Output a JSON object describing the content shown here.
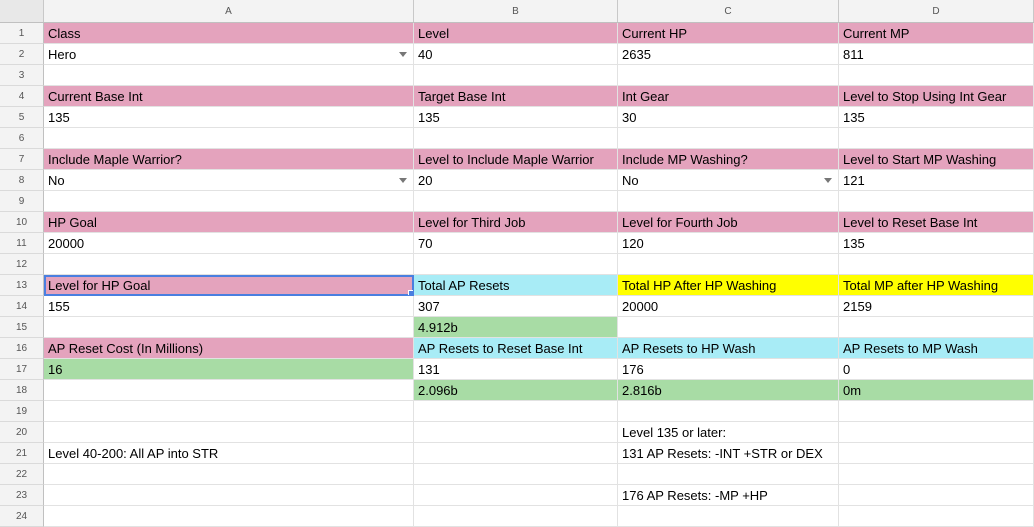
{
  "columns": [
    "A",
    "B",
    "C",
    "D"
  ],
  "rows": [
    {
      "num": "1",
      "cells": [
        {
          "text": "Class",
          "fill": "pink"
        },
        {
          "text": "Level",
          "fill": "pink"
        },
        {
          "text": "Current HP",
          "fill": "pink"
        },
        {
          "text": "Current MP",
          "fill": "pink"
        }
      ]
    },
    {
      "num": "2",
      "cells": [
        {
          "text": "Hero",
          "dropdown": true
        },
        {
          "text": "40"
        },
        {
          "text": "2635"
        },
        {
          "text": "811"
        }
      ]
    },
    {
      "num": "3",
      "cells": [
        {
          "text": ""
        },
        {
          "text": ""
        },
        {
          "text": ""
        },
        {
          "text": ""
        }
      ]
    },
    {
      "num": "4",
      "cells": [
        {
          "text": "Current Base Int",
          "fill": "pink"
        },
        {
          "text": "Target Base Int",
          "fill": "pink"
        },
        {
          "text": "Int Gear",
          "fill": "pink"
        },
        {
          "text": "Level to Stop Using Int Gear",
          "fill": "pink"
        }
      ]
    },
    {
      "num": "5",
      "cells": [
        {
          "text": "135"
        },
        {
          "text": "135"
        },
        {
          "text": "30"
        },
        {
          "text": "135"
        }
      ]
    },
    {
      "num": "6",
      "cells": [
        {
          "text": ""
        },
        {
          "text": ""
        },
        {
          "text": ""
        },
        {
          "text": ""
        }
      ]
    },
    {
      "num": "7",
      "cells": [
        {
          "text": "Include Maple Warrior?",
          "fill": "pink"
        },
        {
          "text": "Level to Include Maple Warrior",
          "fill": "pink"
        },
        {
          "text": "Include MP Washing?",
          "fill": "pink"
        },
        {
          "text": "Level to Start MP Washing",
          "fill": "pink"
        }
      ]
    },
    {
      "num": "8",
      "cells": [
        {
          "text": "No",
          "dropdown": true
        },
        {
          "text": "20"
        },
        {
          "text": "No",
          "dropdown": true
        },
        {
          "text": "121"
        }
      ]
    },
    {
      "num": "9",
      "cells": [
        {
          "text": ""
        },
        {
          "text": ""
        },
        {
          "text": ""
        },
        {
          "text": ""
        }
      ]
    },
    {
      "num": "10",
      "cells": [
        {
          "text": "HP Goal",
          "fill": "pink"
        },
        {
          "text": "Level for Third Job",
          "fill": "pink"
        },
        {
          "text": "Level for Fourth Job",
          "fill": "pink"
        },
        {
          "text": "Level to Reset Base Int",
          "fill": "pink"
        }
      ]
    },
    {
      "num": "11",
      "cells": [
        {
          "text": "20000"
        },
        {
          "text": "70"
        },
        {
          "text": "120"
        },
        {
          "text": "135"
        }
      ]
    },
    {
      "num": "12",
      "cells": [
        {
          "text": ""
        },
        {
          "text": ""
        },
        {
          "text": ""
        },
        {
          "text": ""
        }
      ]
    },
    {
      "num": "13",
      "cells": [
        {
          "text": "Level for HP Goal",
          "fill": "pink",
          "selected": true
        },
        {
          "text": "Total AP Resets",
          "fill": "cyan"
        },
        {
          "text": "Total HP After HP Washing",
          "fill": "yellow"
        },
        {
          "text": "Total MP after HP Washing",
          "fill": "yellow"
        }
      ]
    },
    {
      "num": "14",
      "cells": [
        {
          "text": "155"
        },
        {
          "text": "307"
        },
        {
          "text": "20000"
        },
        {
          "text": "2159"
        }
      ]
    },
    {
      "num": "15",
      "cells": [
        {
          "text": ""
        },
        {
          "text": "4.912b",
          "fill": "green"
        },
        {
          "text": ""
        },
        {
          "text": ""
        }
      ]
    },
    {
      "num": "16",
      "cells": [
        {
          "text": "AP Reset Cost (In Millions)",
          "fill": "pink"
        },
        {
          "text": "AP Resets to Reset Base Int",
          "fill": "cyan"
        },
        {
          "text": "AP Resets to HP Wash",
          "fill": "cyan"
        },
        {
          "text": "AP Resets to MP Wash",
          "fill": "cyan"
        }
      ]
    },
    {
      "num": "17",
      "cells": [
        {
          "text": "16",
          "fill": "green"
        },
        {
          "text": "131"
        },
        {
          "text": "176"
        },
        {
          "text": "0"
        }
      ]
    },
    {
      "num": "18",
      "cells": [
        {
          "text": ""
        },
        {
          "text": "2.096b",
          "fill": "green"
        },
        {
          "text": "2.816b",
          "fill": "green"
        },
        {
          "text": "0m",
          "fill": "green"
        }
      ]
    },
    {
      "num": "19",
      "cells": [
        {
          "text": ""
        },
        {
          "text": ""
        },
        {
          "text": ""
        },
        {
          "text": ""
        }
      ]
    },
    {
      "num": "20",
      "cells": [
        {
          "text": ""
        },
        {
          "text": ""
        },
        {
          "text": "Level 135 or later:"
        },
        {
          "text": ""
        }
      ]
    },
    {
      "num": "21",
      "cells": [
        {
          "text": "Level 40-200: All AP into STR"
        },
        {
          "text": ""
        },
        {
          "text": "131 AP Resets: -INT +STR or DEX"
        },
        {
          "text": ""
        }
      ]
    },
    {
      "num": "22",
      "cells": [
        {
          "text": ""
        },
        {
          "text": ""
        },
        {
          "text": ""
        },
        {
          "text": ""
        }
      ]
    },
    {
      "num": "23",
      "cells": [
        {
          "text": ""
        },
        {
          "text": ""
        },
        {
          "text": "176 AP Resets: -MP +HP"
        },
        {
          "text": ""
        }
      ]
    },
    {
      "num": "24",
      "cells": [
        {
          "text": ""
        },
        {
          "text": ""
        },
        {
          "text": ""
        },
        {
          "text": ""
        }
      ]
    }
  ]
}
